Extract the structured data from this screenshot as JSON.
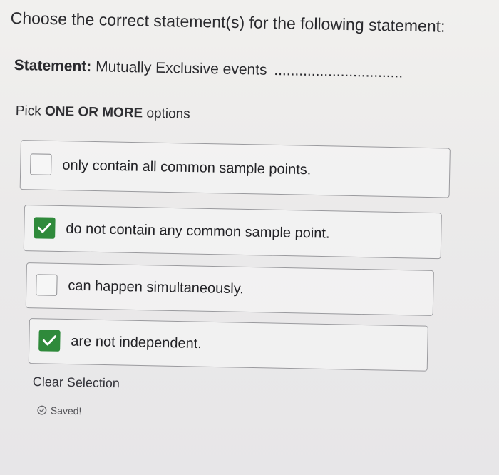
{
  "question": {
    "title": "Choose the correct statement(s) for the following statement:"
  },
  "statement": {
    "label": "Statement:",
    "text": "Mutually Exclusive events",
    "blank": "..............................."
  },
  "instruction": {
    "prefix": "Pick",
    "emphasis": "ONE OR MORE",
    "suffix": "options"
  },
  "options": [
    {
      "text": "only contain all common sample points.",
      "checked": false
    },
    {
      "text": "do not contain any common sample point.",
      "checked": true
    },
    {
      "text": "can happen simultaneously.",
      "checked": false
    },
    {
      "text": "are not independent.",
      "checked": true
    }
  ],
  "actions": {
    "clear_label": "Clear Selection"
  },
  "status": {
    "saved_label": "Saved!",
    "icon": "check-circle-icon"
  },
  "colors": {
    "check_green": "#2f8a3b"
  }
}
